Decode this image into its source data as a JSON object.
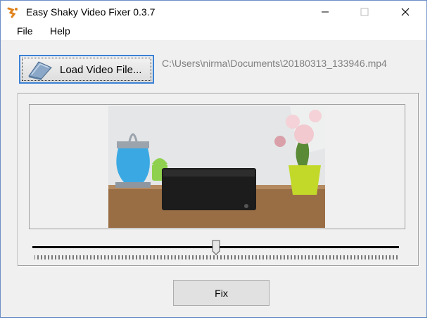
{
  "window": {
    "title": "Easy Shaky Video Fixer 0.3.7",
    "accent": "#6b8fc7"
  },
  "menu": {
    "items": [
      {
        "label": "File"
      },
      {
        "label": "Help"
      }
    ]
  },
  "toolbar": {
    "load_label": "Load Video File...",
    "file_path": "C:\\Users\\nirma\\Documents\\20180313_133946.mp4"
  },
  "player": {
    "position_fraction": 0.5
  },
  "actions": {
    "fix_label": "Fix"
  },
  "icons": {
    "app": "app-logo-icon",
    "load": "open-file-icon",
    "minimize": "minimize-icon",
    "maximize": "maximize-icon",
    "close": "close-icon"
  }
}
